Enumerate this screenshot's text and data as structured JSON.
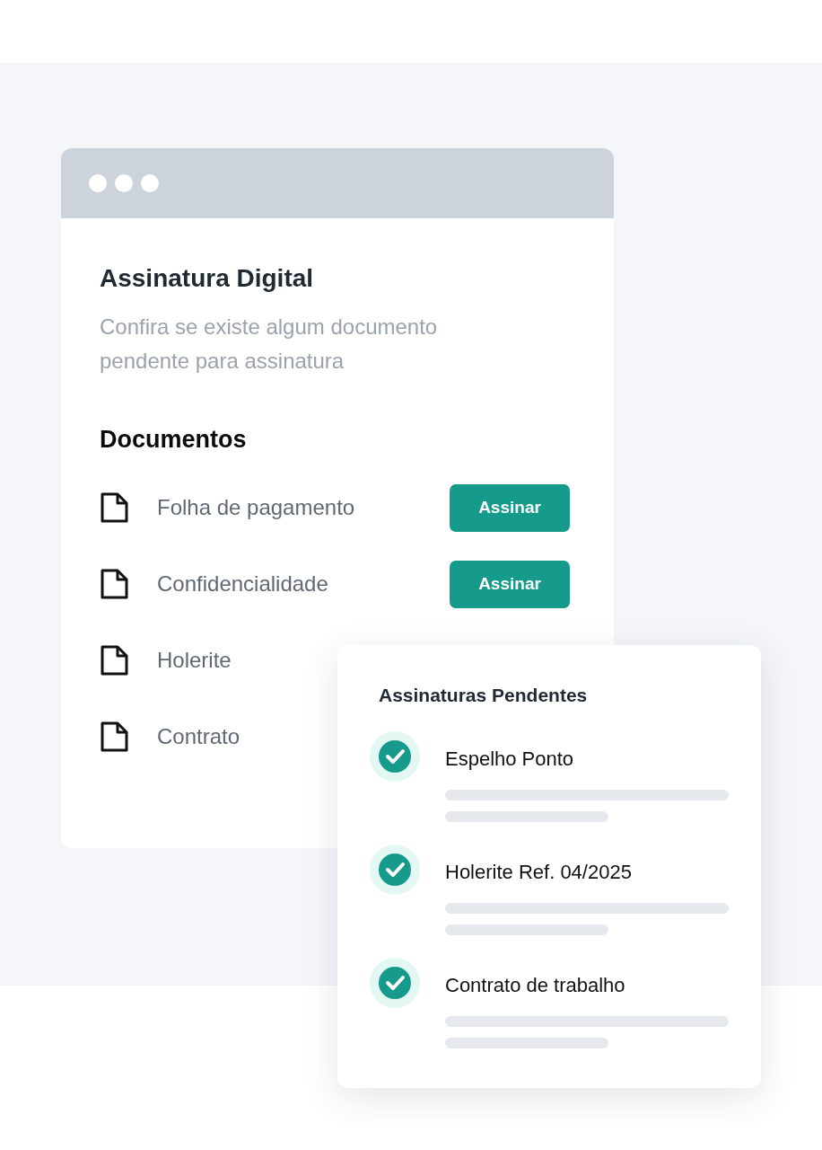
{
  "browser_window": {
    "title": "Assinatura Digital",
    "subtitle": "Confira se existe algum documento pendente para assinatura",
    "section": "Documentos",
    "documents": [
      {
        "name": "Folha de pagamento",
        "action": "Assinar"
      },
      {
        "name": "Confidencialidade",
        "action": "Assinar"
      },
      {
        "name": "Holerite"
      },
      {
        "name": "Contrato"
      }
    ]
  },
  "pending_panel": {
    "title": "Assinaturas Pendentes",
    "items": [
      {
        "name": "Espelho Ponto",
        "checked": true
      },
      {
        "name": "Holerite Ref. 04/2025",
        "checked": true
      },
      {
        "name": "Contrato de trabalho",
        "checked": true
      }
    ]
  }
}
